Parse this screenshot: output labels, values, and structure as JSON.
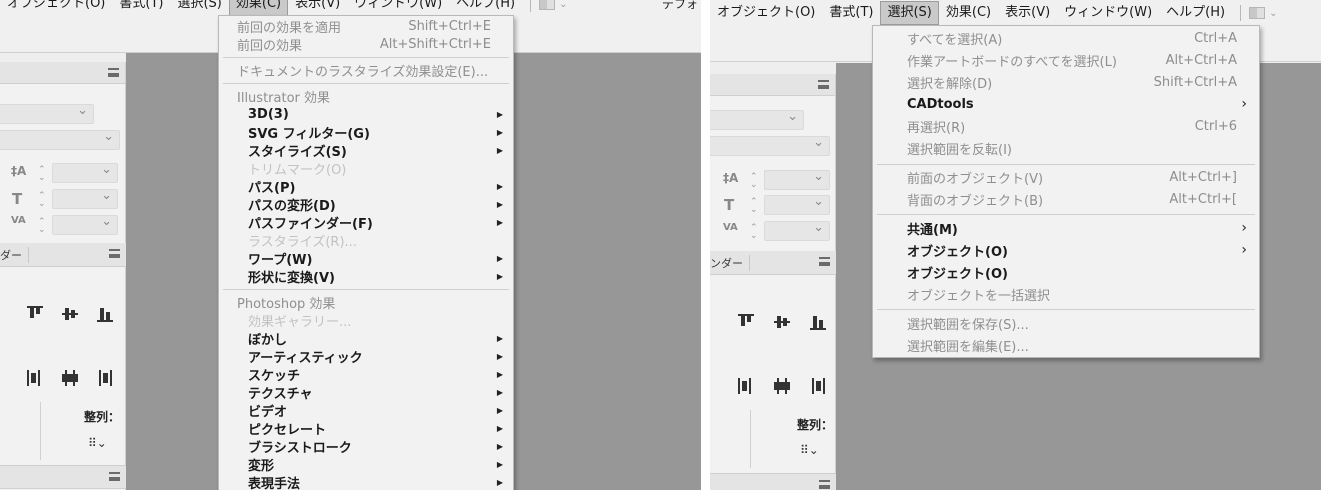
{
  "left": {
    "menubar": [
      {
        "label": "オブジェクト(O)",
        "active": false
      },
      {
        "label": "書式(T)",
        "active": false
      },
      {
        "label": "選択(S)",
        "active": false
      },
      {
        "label": "効果(C)",
        "active": true
      },
      {
        "label": "表示(V)",
        "active": false
      },
      {
        "label": "ウィンドウ(W)",
        "active": false
      },
      {
        "label": "ヘルプ(H)",
        "active": false
      }
    ],
    "workspace_label": "デフォ",
    "panel_tab": "ダー",
    "align_label": "整列：",
    "effect_menu": {
      "apply_last": {
        "label": "前回の効果を適用",
        "shortcut": "Shift+Ctrl+E"
      },
      "last_effect": {
        "label": "前回の効果",
        "shortcut": "Alt+Shift+Ctrl+E"
      },
      "raster_settings": "ドキュメントのラスタライズ効果設定(E)...",
      "illustrator_header": "Illustrator 効果",
      "illustrator_items": [
        {
          "label": "3D(3)",
          "enabled": true,
          "submenu": true
        },
        {
          "label": "SVG フィルター(G)",
          "enabled": true,
          "submenu": true
        },
        {
          "label": "スタイライズ(S)",
          "enabled": true,
          "submenu": true
        },
        {
          "label": "トリムマーク(O)",
          "enabled": false,
          "submenu": false
        },
        {
          "label": "パス(P)",
          "enabled": true,
          "submenu": true
        },
        {
          "label": "パスの変形(D)",
          "enabled": true,
          "submenu": true
        },
        {
          "label": "パスファインダー(F)",
          "enabled": true,
          "submenu": true
        },
        {
          "label": "ラスタライズ(R)...",
          "enabled": false,
          "submenu": false
        },
        {
          "label": "ワープ(W)",
          "enabled": true,
          "submenu": true
        },
        {
          "label": "形状に変換(V)",
          "enabled": true,
          "submenu": true
        }
      ],
      "photoshop_header": "Photoshop 効果",
      "photoshop_items": [
        {
          "label": "効果ギャラリー...",
          "enabled": false,
          "submenu": false
        },
        {
          "label": "ぼかし",
          "enabled": true,
          "submenu": true
        },
        {
          "label": "アーティスティック",
          "enabled": true,
          "submenu": true
        },
        {
          "label": "スケッチ",
          "enabled": true,
          "submenu": true
        },
        {
          "label": "テクスチャ",
          "enabled": true,
          "submenu": true
        },
        {
          "label": "ビデオ",
          "enabled": true,
          "submenu": true
        },
        {
          "label": "ピクセレート",
          "enabled": true,
          "submenu": true
        },
        {
          "label": "ブラシストローク",
          "enabled": true,
          "submenu": true
        },
        {
          "label": "変形",
          "enabled": true,
          "submenu": true
        },
        {
          "label": "表現手法",
          "enabled": true,
          "submenu": true
        }
      ]
    }
  },
  "right": {
    "menubar": [
      {
        "label": "オブジェクト(O)",
        "active": false
      },
      {
        "label": "書式(T)",
        "active": false
      },
      {
        "label": "選択(S)",
        "active": true
      },
      {
        "label": "効果(C)",
        "active": false
      },
      {
        "label": "表示(V)",
        "active": false
      },
      {
        "label": "ウィンドウ(W)",
        "active": false
      },
      {
        "label": "ヘルプ(H)",
        "active": false
      }
    ],
    "panel_tab": "ンダー",
    "align_label": "整列：",
    "select_menu": {
      "group1": [
        {
          "label": "すべてを選択(A)",
          "shortcut": "Ctrl+A",
          "style": "dis",
          "submenu": false
        },
        {
          "label": "作業アートボードのすべてを選択(L)",
          "shortcut": "Alt+Ctrl+A",
          "style": "dis",
          "submenu": false
        },
        {
          "label": "選択を解除(D)",
          "shortcut": "Shift+Ctrl+A",
          "style": "dis",
          "submenu": false
        },
        {
          "label": "CADtools",
          "shortcut": "",
          "style": "bold",
          "submenu": true
        },
        {
          "label": "再選択(R)",
          "shortcut": "Ctrl+6",
          "style": "dis",
          "submenu": false
        },
        {
          "label": "選択範囲を反転(I)",
          "shortcut": "",
          "style": "dis",
          "submenu": false
        }
      ],
      "group2": [
        {
          "label": "前面のオブジェクト(V)",
          "shortcut": "Alt+Ctrl+]",
          "style": "dis",
          "submenu": false
        },
        {
          "label": "背面のオブジェクト(B)",
          "shortcut": "Alt+Ctrl+[",
          "style": "dis",
          "submenu": false
        }
      ],
      "group3": [
        {
          "label": "共通(M)",
          "shortcut": "",
          "style": "bold",
          "submenu": true
        },
        {
          "label": "オブジェクト(O)",
          "shortcut": "",
          "style": "bold",
          "submenu": true
        },
        {
          "label": "オブジェクト(O)",
          "shortcut": "",
          "style": "bold",
          "submenu": false
        },
        {
          "label": "オブジェクトを一括選択",
          "shortcut": "",
          "style": "dis",
          "submenu": false
        }
      ],
      "group4": [
        {
          "label": "選択範囲を保存(S)...",
          "shortcut": "",
          "style": "dis",
          "submenu": false
        },
        {
          "label": "選択範囲を編集(E)...",
          "shortcut": "",
          "style": "dis",
          "submenu": false
        }
      ]
    }
  }
}
